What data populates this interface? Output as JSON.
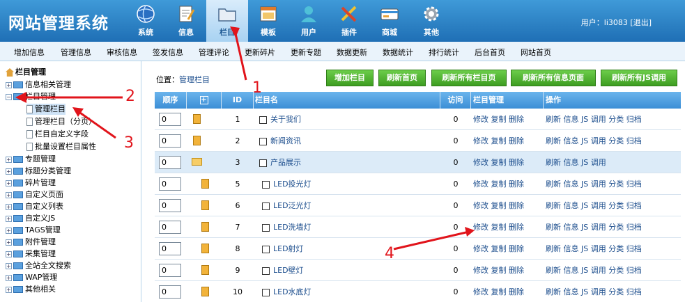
{
  "app_title": "网站管理系统",
  "topnav": [
    {
      "label": "系统",
      "icon": "globe-icon"
    },
    {
      "label": "信息",
      "icon": "document-edit-icon"
    },
    {
      "label": "栏目",
      "icon": "folder-icon",
      "active": true
    },
    {
      "label": "模板",
      "icon": "window-icon"
    },
    {
      "label": "用户",
      "icon": "user-icon"
    },
    {
      "label": "插件",
      "icon": "tools-icon"
    },
    {
      "label": "商城",
      "icon": "card-icon"
    },
    {
      "label": "其他",
      "icon": "gear-icon"
    }
  ],
  "user": {
    "prefix": "用户：",
    "name": "li3083",
    "logout": "[退出]"
  },
  "subnav": [
    "增加信息",
    "管理信息",
    "审核信息",
    "签发信息",
    "管理评论",
    "更新碎片",
    "更新专题",
    "数据更新",
    "数据统计",
    "排行统计",
    "后台首页",
    "网站首页"
  ],
  "tree": {
    "root": "栏目管理",
    "items": [
      {
        "label": "信息相关管理",
        "expanded": false
      },
      {
        "label": "栏目管理",
        "expanded": true,
        "children": [
          "管理栏目",
          "管理栏目（分页）",
          "栏目自定义字段",
          "批量设置栏目属性"
        ]
      },
      {
        "label": "专题管理"
      },
      {
        "label": "标题分类管理"
      },
      {
        "label": "碎片管理"
      },
      {
        "label": "自定义页面"
      },
      {
        "label": "自定义列表"
      },
      {
        "label": "自定义JS"
      },
      {
        "label": "TAGS管理"
      },
      {
        "label": "附件管理"
      },
      {
        "label": "采集管理"
      },
      {
        "label": "全站全文搜索"
      },
      {
        "label": "WAP管理"
      },
      {
        "label": "其他相关"
      }
    ]
  },
  "location": {
    "label": "位置：",
    "link": "管理栏目"
  },
  "buttons": [
    "增加栏目",
    "刷新首页",
    "刷新所有栏目页",
    "刷新所有信息页面",
    "刷新所有JS调用"
  ],
  "table": {
    "headers": [
      "顺序",
      "+",
      "ID",
      "栏目名",
      "访问",
      "栏目管理",
      "操作"
    ],
    "manage_actions": [
      "修改",
      "复制",
      "删除"
    ],
    "rows": [
      {
        "order": "0",
        "icon": "file",
        "id": "1",
        "name": "关于我们",
        "visits": "0",
        "ops": [
          "刷新",
          "信息",
          "JS",
          "调用",
          "分类",
          "归档"
        ]
      },
      {
        "order": "0",
        "icon": "file",
        "id": "2",
        "name": "新闻资讯",
        "visits": "0",
        "ops": [
          "刷新",
          "信息",
          "JS",
          "调用",
          "分类",
          "归档"
        ]
      },
      {
        "order": "0",
        "icon": "folder",
        "id": "3",
        "name": "产品展示",
        "visits": "0",
        "ops": [
          "刷新",
          "信息",
          "JS",
          "调用"
        ],
        "highlight": true
      },
      {
        "order": "0",
        "icon": "file",
        "id": "5",
        "name": "LED投光灯",
        "visits": "0",
        "ops": [
          "刷新",
          "信息",
          "JS",
          "调用",
          "分类",
          "归档"
        ],
        "indent": true
      },
      {
        "order": "0",
        "icon": "file",
        "id": "6",
        "name": "LED泛光灯",
        "visits": "0",
        "ops": [
          "刷新",
          "信息",
          "JS",
          "调用",
          "分类",
          "归档"
        ],
        "indent": true
      },
      {
        "order": "0",
        "icon": "file",
        "id": "7",
        "name": "LED洗墙灯",
        "visits": "0",
        "ops": [
          "刷新",
          "信息",
          "JS",
          "调用",
          "分类",
          "归档"
        ],
        "indent": true
      },
      {
        "order": "0",
        "icon": "file",
        "id": "8",
        "name": "LED射灯",
        "visits": "0",
        "ops": [
          "刷新",
          "信息",
          "JS",
          "调用",
          "分类",
          "归档"
        ],
        "indent": true
      },
      {
        "order": "0",
        "icon": "file",
        "id": "9",
        "name": "LED壁灯",
        "visits": "0",
        "ops": [
          "刷新",
          "信息",
          "JS",
          "调用",
          "分类",
          "归档"
        ],
        "indent": true
      },
      {
        "order": "0",
        "icon": "file",
        "id": "10",
        "name": "LED水底灯",
        "visits": "0",
        "ops": [
          "刷新",
          "信息",
          "JS",
          "调用",
          "分类",
          "归档"
        ],
        "indent": true
      }
    ]
  },
  "annotations": [
    "1",
    "2",
    "3",
    "4"
  ],
  "colors": {
    "header": "#2b7fc6",
    "accent_red": "#e1141b",
    "button_green": "#4fb02c",
    "link": "#1a4c8c"
  }
}
